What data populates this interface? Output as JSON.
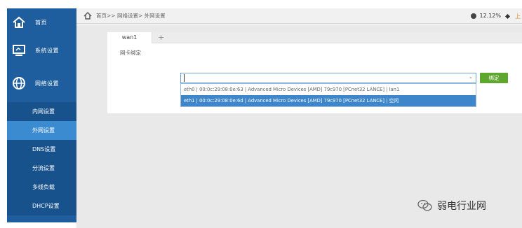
{
  "sidebar": {
    "main_items": [
      {
        "label": "首页",
        "icon": "home-icon"
      },
      {
        "label": "系统设置",
        "icon": "monitor-icon"
      },
      {
        "label": "网络设置",
        "icon": "globe-icon"
      }
    ],
    "sub_items": [
      "内网设置",
      "外网设置",
      "DNS设置",
      "分流设置",
      "多线负载",
      "DHCP设置"
    ],
    "active_sub": "外网设置",
    "colors": {
      "bg": "#1f5e9e",
      "active": "#3b8bd1"
    }
  },
  "topbar": {
    "breadcrumb": "首页>>  网络设置>  外网设置",
    "cpu_percent": "12.12%",
    "right_text": "上"
  },
  "tabs": {
    "active": "wan1",
    "add": "+"
  },
  "form": {
    "nic_label": "网卡绑定",
    "select_value": "",
    "options": [
      "eth0 | 00:0c:29:08:0e:63 | Advanced Micro Devices [AMD] 79c970 [PCnet32 LANCE] | lan1",
      "eth1 | 00:0c:29:08:0e:6d | Advanced Micro Devices [AMD] 79c970 [PCnet32 LANCE] | 空闲"
    ],
    "bind_button": "绑定"
  },
  "watermark": {
    "text": "弱电行业网"
  }
}
